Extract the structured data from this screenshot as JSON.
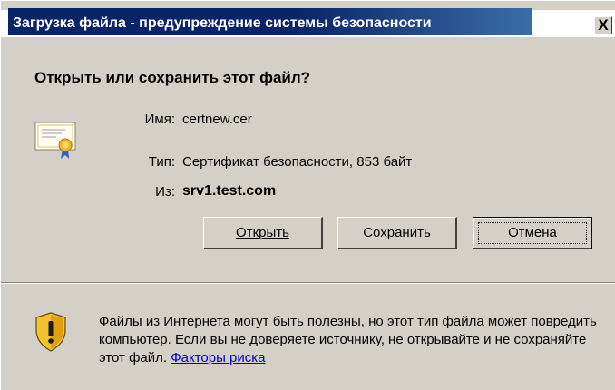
{
  "window": {
    "title": "Загрузка файла - предупреждение системы безопасности",
    "close_label": "X"
  },
  "dialog": {
    "heading": "Открыть или сохранить этот файл?",
    "name_label": "Имя:",
    "name_value": "certnew.cer",
    "type_label": "Тип:",
    "type_value": "Сертификат безопасности, 853 байт",
    "from_label": "Из:",
    "from_value": "srv1.test.com"
  },
  "buttons": {
    "open": "Открыть",
    "save": "Сохранить",
    "cancel": "Отмена"
  },
  "warning": {
    "text": "Файлы из Интернета могут быть полезны, но этот тип файла может повредить компьютер. Если вы не доверяете источнику, не открывайте и не сохраняйте этот файл.",
    "link": "Факторы риска"
  },
  "icons": {
    "file": "certificate-icon",
    "warning": "warning-shield-icon"
  }
}
